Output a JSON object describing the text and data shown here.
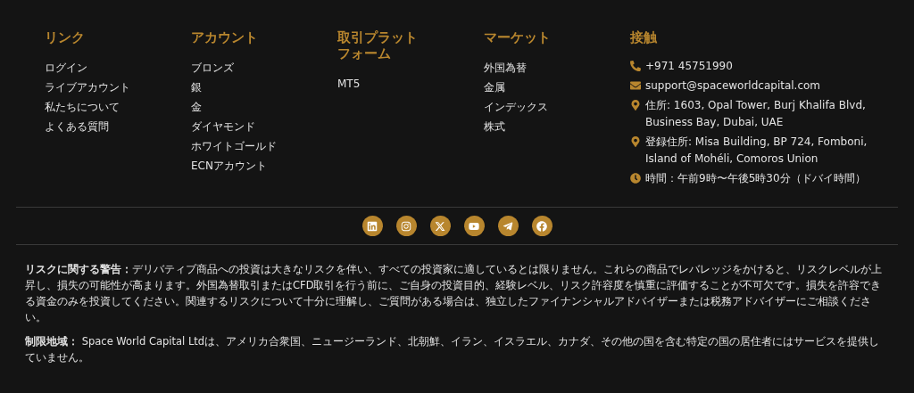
{
  "columns": [
    {
      "heading": "リンク",
      "links": [
        "ログイン",
        "ライブアカウント",
        "私たちについて",
        "よくある質問"
      ]
    },
    {
      "heading": "アカウント",
      "links": [
        "ブロンズ",
        "銀",
        "金",
        "ダイヤモンド",
        "ホワイトゴールド",
        "ECNアカウント"
      ]
    },
    {
      "heading": "取引プラットフォーム",
      "links": [
        "MT5"
      ]
    },
    {
      "heading": "マーケット",
      "links": [
        "外国為替",
        "金属",
        "インデックス",
        "株式"
      ]
    }
  ],
  "contact": {
    "heading": "接触",
    "items": [
      {
        "kind": "phone",
        "text": "+971 45751990"
      },
      {
        "kind": "email",
        "text": "support@spaceworldcapital.com"
      },
      {
        "kind": "pin",
        "text": "住所: 1603, Opal Tower, Burj Khalifa Blvd, Business Bay, Dubai, UAE"
      },
      {
        "kind": "pin",
        "text": "登録住所: Misa Building, BP 724, Fomboni, Island of Mohéli, Comoros Union"
      },
      {
        "kind": "clock",
        "text": "時間：午前9時〜午後5時30分（ドバイ時間）"
      }
    ]
  },
  "social": [
    {
      "kind": "linkedin"
    },
    {
      "kind": "instagram"
    },
    {
      "kind": "x"
    },
    {
      "kind": "youtube"
    },
    {
      "kind": "telegram"
    },
    {
      "kind": "facebook"
    }
  ],
  "disclaimers": [
    "**リスクに関する警告：**デリバティブ商品への投資は大きなリスクを伴い、すべての投資家に適しているとは限りません。これらの商品でレバレッジをかけると、リスクレベルが上昇し、損失の可能性が高まります。外国為替取引またはCFD取引を行う前に、ご自身の投資目的、経験レベル、リスク許容度を慎重に評価することが不可欠です。損失を許容できる資金のみを投資してください。関連するリスクについて十分に理解し、ご質問がある場合は、独立したファイナンシャルアドバイザーまたは税務アドバイザーにご相談ください。",
    "**制限地域：** Space World Capital Ltdは、アメリカ合衆国、ニュージーランド、北朝鮮、イラン、イスラエル、カナダ、その他の国を含む特定の国の居住者にはサービスを提供していません。"
  ]
}
